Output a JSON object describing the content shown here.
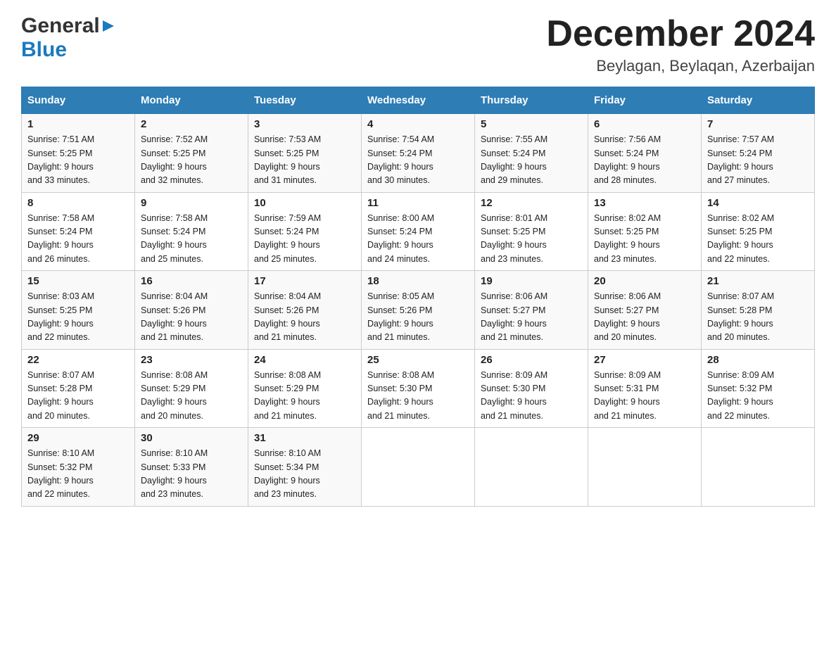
{
  "header": {
    "logo_general": "General",
    "logo_blue": "Blue",
    "month_title": "December 2024",
    "location": "Beylagan, Beylaqan, Azerbaijan"
  },
  "days_of_week": [
    "Sunday",
    "Monday",
    "Tuesday",
    "Wednesday",
    "Thursday",
    "Friday",
    "Saturday"
  ],
  "weeks": [
    [
      {
        "day": "1",
        "sunrise": "7:51 AM",
        "sunset": "5:25 PM",
        "daylight": "9 hours and 33 minutes."
      },
      {
        "day": "2",
        "sunrise": "7:52 AM",
        "sunset": "5:25 PM",
        "daylight": "9 hours and 32 minutes."
      },
      {
        "day": "3",
        "sunrise": "7:53 AM",
        "sunset": "5:25 PM",
        "daylight": "9 hours and 31 minutes."
      },
      {
        "day": "4",
        "sunrise": "7:54 AM",
        "sunset": "5:24 PM",
        "daylight": "9 hours and 30 minutes."
      },
      {
        "day": "5",
        "sunrise": "7:55 AM",
        "sunset": "5:24 PM",
        "daylight": "9 hours and 29 minutes."
      },
      {
        "day": "6",
        "sunrise": "7:56 AM",
        "sunset": "5:24 PM",
        "daylight": "9 hours and 28 minutes."
      },
      {
        "day": "7",
        "sunrise": "7:57 AM",
        "sunset": "5:24 PM",
        "daylight": "9 hours and 27 minutes."
      }
    ],
    [
      {
        "day": "8",
        "sunrise": "7:58 AM",
        "sunset": "5:24 PM",
        "daylight": "9 hours and 26 minutes."
      },
      {
        "day": "9",
        "sunrise": "7:58 AM",
        "sunset": "5:24 PM",
        "daylight": "9 hours and 25 minutes."
      },
      {
        "day": "10",
        "sunrise": "7:59 AM",
        "sunset": "5:24 PM",
        "daylight": "9 hours and 25 minutes."
      },
      {
        "day": "11",
        "sunrise": "8:00 AM",
        "sunset": "5:24 PM",
        "daylight": "9 hours and 24 minutes."
      },
      {
        "day": "12",
        "sunrise": "8:01 AM",
        "sunset": "5:25 PM",
        "daylight": "9 hours and 23 minutes."
      },
      {
        "day": "13",
        "sunrise": "8:02 AM",
        "sunset": "5:25 PM",
        "daylight": "9 hours and 23 minutes."
      },
      {
        "day": "14",
        "sunrise": "8:02 AM",
        "sunset": "5:25 PM",
        "daylight": "9 hours and 22 minutes."
      }
    ],
    [
      {
        "day": "15",
        "sunrise": "8:03 AM",
        "sunset": "5:25 PM",
        "daylight": "9 hours and 22 minutes."
      },
      {
        "day": "16",
        "sunrise": "8:04 AM",
        "sunset": "5:26 PM",
        "daylight": "9 hours and 21 minutes."
      },
      {
        "day": "17",
        "sunrise": "8:04 AM",
        "sunset": "5:26 PM",
        "daylight": "9 hours and 21 minutes."
      },
      {
        "day": "18",
        "sunrise": "8:05 AM",
        "sunset": "5:26 PM",
        "daylight": "9 hours and 21 minutes."
      },
      {
        "day": "19",
        "sunrise": "8:06 AM",
        "sunset": "5:27 PM",
        "daylight": "9 hours and 21 minutes."
      },
      {
        "day": "20",
        "sunrise": "8:06 AM",
        "sunset": "5:27 PM",
        "daylight": "9 hours and 20 minutes."
      },
      {
        "day": "21",
        "sunrise": "8:07 AM",
        "sunset": "5:28 PM",
        "daylight": "9 hours and 20 minutes."
      }
    ],
    [
      {
        "day": "22",
        "sunrise": "8:07 AM",
        "sunset": "5:28 PM",
        "daylight": "9 hours and 20 minutes."
      },
      {
        "day": "23",
        "sunrise": "8:08 AM",
        "sunset": "5:29 PM",
        "daylight": "9 hours and 20 minutes."
      },
      {
        "day": "24",
        "sunrise": "8:08 AM",
        "sunset": "5:29 PM",
        "daylight": "9 hours and 21 minutes."
      },
      {
        "day": "25",
        "sunrise": "8:08 AM",
        "sunset": "5:30 PM",
        "daylight": "9 hours and 21 minutes."
      },
      {
        "day": "26",
        "sunrise": "8:09 AM",
        "sunset": "5:30 PM",
        "daylight": "9 hours and 21 minutes."
      },
      {
        "day": "27",
        "sunrise": "8:09 AM",
        "sunset": "5:31 PM",
        "daylight": "9 hours and 21 minutes."
      },
      {
        "day": "28",
        "sunrise": "8:09 AM",
        "sunset": "5:32 PM",
        "daylight": "9 hours and 22 minutes."
      }
    ],
    [
      {
        "day": "29",
        "sunrise": "8:10 AM",
        "sunset": "5:32 PM",
        "daylight": "9 hours and 22 minutes."
      },
      {
        "day": "30",
        "sunrise": "8:10 AM",
        "sunset": "5:33 PM",
        "daylight": "9 hours and 23 minutes."
      },
      {
        "day": "31",
        "sunrise": "8:10 AM",
        "sunset": "5:34 PM",
        "daylight": "9 hours and 23 minutes."
      },
      null,
      null,
      null,
      null
    ]
  ],
  "labels": {
    "sunrise": "Sunrise:",
    "sunset": "Sunset:",
    "daylight": "Daylight:"
  }
}
